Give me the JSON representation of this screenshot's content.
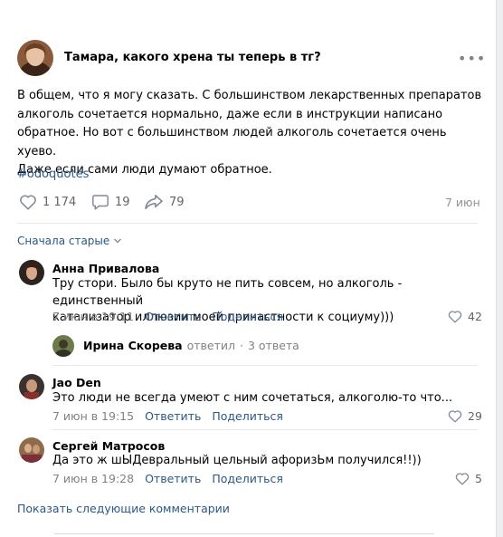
{
  "post": {
    "title": "Тамара, какого хрена ты теперь в тг?",
    "more": "•••",
    "body_lines": [
      "В общем, что я могу сказать. С большинством лекарственных препаратов",
      "алкоголь сочетается нормально, даже если в инструкции написано",
      "обратное. Но вот с большинством людей алкоголь сочетается очень хуево.",
      "Даже если сами люди думают обратное."
    ],
    "hashtag": "#odoquotes",
    "likes": "1 174",
    "comments": "19",
    "shares": "79",
    "date": "7 июн"
  },
  "sort_label": "Сначала старые",
  "comments": [
    {
      "name": "Анна Привалова",
      "lines": [
        "Тру стори. Было бы круто не пить совсем, но алкоголь - единственный",
        "катализатор иллюзии моей причастности к социуму)))"
      ],
      "time": "7 июн в 19:11",
      "reply": "Ответить",
      "share": "Поделиться",
      "likes": "42"
    },
    {
      "name": "Jao Den",
      "lines": [
        "Это люди не всегда умеют с ним сочетаться, алкоголю-то что..."
      ],
      "time": "7 июн в 19:15",
      "reply": "Ответить",
      "share": "Поделиться",
      "likes": "29"
    },
    {
      "name": "Сергей Матросов",
      "lines": [
        "Да это ж шЫДевральный цельный афоризЬм получился!!))"
      ],
      "time": "7 июн в 19:28",
      "reply": "Ответить",
      "share": "Поделиться",
      "likes": "5"
    }
  ],
  "reply_thread": {
    "name": "Ирина Скорева",
    "verb": "ответил",
    "sep": "·",
    "count": "3 ответа"
  },
  "show_more": "Показать следующие комментарии",
  "colors": {
    "link": "#2a5885",
    "meta": "#828282",
    "divider": "#e7e8ec"
  }
}
